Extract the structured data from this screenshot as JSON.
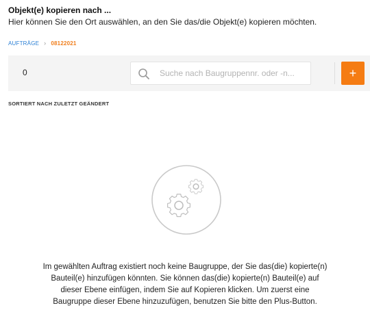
{
  "header": {
    "title": "Objekt(e) kopieren nach ...",
    "subtitle": "Hier können Sie den Ort auswählen, an den Sie das/die Objekt(e) kopieren möchten."
  },
  "breadcrumb": {
    "root": "AUFTRÄGE",
    "separator": "›",
    "current": "08122021"
  },
  "toolbar": {
    "count": "0",
    "search_placeholder": "Suche nach Baugruppennr. oder -n...",
    "search_value": "",
    "add_label": "+"
  },
  "sort": {
    "label": "SORTIERT NACH ZULETZT GEÄNDERT"
  },
  "empty_state": {
    "icon": "gears-icon",
    "message": "Im gewählten Auftrag existiert noch keine Baugruppe, der Sie das(die) kopierte(n) Bauteil(e) hinzufügen könnten. Sie können das(die) kopierte(n) Bauteil(e) auf dieser Ebene einfügen, indem Sie auf Kopieren klicken. Um zuerst eine Baugruppe dieser Ebene hinzuzufügen, benutzen Sie bitte den Plus-Button."
  },
  "colors": {
    "accent": "#f57c13",
    "link": "#2a7fd4",
    "toolbar_bg": "#f4f4f4"
  }
}
